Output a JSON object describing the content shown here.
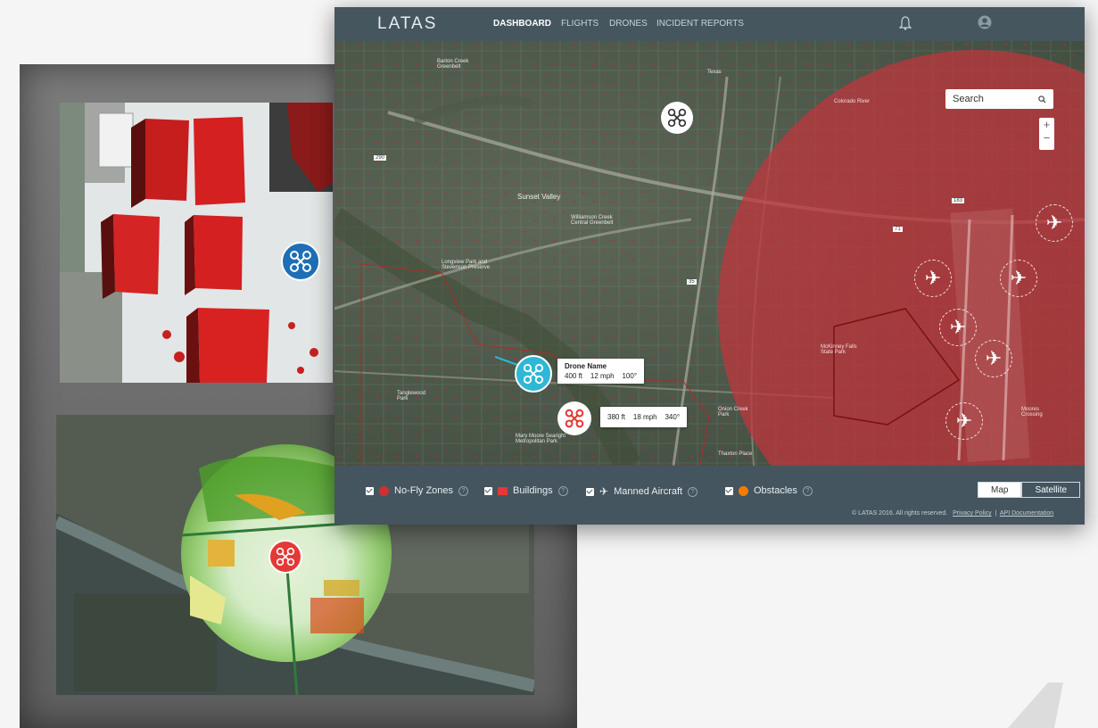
{
  "app": {
    "logo": "LATAS"
  },
  "nav": [
    {
      "label": "DASHBOARD",
      "active": true
    },
    {
      "label": "FLIGHTS",
      "active": false
    },
    {
      "label": "DRONES",
      "active": false
    },
    {
      "label": "INCIDENT REPORTS",
      "active": false
    }
  ],
  "header_icons": {
    "notifications": "bell-icon",
    "profile": "user-icon"
  },
  "search": {
    "placeholder": "Search"
  },
  "zoom": {
    "in": "+",
    "out": "−"
  },
  "map_labels": {
    "barton_creek": "Barton Creek Greenbelt",
    "sunset_valley": "Sunset Valley",
    "williamson": "Williamson Creek Central Greenbelt",
    "longview": "Longview Park and Stevenson Preserve",
    "tanglewood": "Tanglewood Park",
    "mary_moore": "Mary Moore Searight Metropolitan Park",
    "onion_creek": "Onion Creek Park",
    "thaxton": "Thaxton Place",
    "mckinney": "McKinney Falls State Park",
    "moores": "Moores Crossing",
    "colorado": "Colorado River",
    "texas": "Texas",
    "hwy_290": "290",
    "hwy_71": "71",
    "hwy_183": "183",
    "hwy_35": "35"
  },
  "drones": [
    {
      "name": "Drone Name",
      "altitude": "400 ft",
      "speed": "12 mph",
      "heading": "100°",
      "color": "#2fb7d6"
    },
    {
      "altitude": "380 ft",
      "speed": "18 mph",
      "heading": "340°",
      "color": "#e53935"
    }
  ],
  "legend": [
    {
      "label": "No-Fly Zones",
      "symbol_color": "#d32f2f",
      "icon": "circle-icon"
    },
    {
      "label": "Buildings",
      "symbol_color": "#e53935",
      "icon": "building-icon"
    },
    {
      "label": "Manned Aircraft",
      "symbol_color": "#ffffff",
      "icon": "plane-icon"
    },
    {
      "label": "Obstacles",
      "symbol_color": "#f57c00",
      "icon": "circle-icon"
    }
  ],
  "map_toggle": [
    {
      "label": "Map",
      "active": true
    },
    {
      "label": "Satellite",
      "active": false
    }
  ],
  "footer": {
    "copyright": "© LATAS 2016. All rights reserved.",
    "privacy": "Privacy Policy",
    "separator": "|",
    "api_docs": "API Documentation"
  },
  "colors": {
    "header_bg": "#46565f",
    "no_fly_zone": "#c0392b",
    "drone_blue": "#2fb7d6",
    "drone_red": "#e53935"
  }
}
